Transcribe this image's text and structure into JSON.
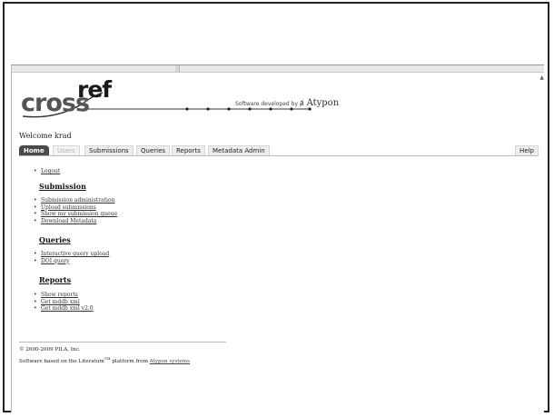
{
  "header": {
    "logo_cross": "cross",
    "logo_ref": "ref",
    "atypon_prefix": "Software developed by",
    "atypon_brand": "Atypon"
  },
  "welcome": "Welcome krad",
  "nav": {
    "tabs": [
      {
        "label": "Home"
      },
      {
        "label": "Users"
      },
      {
        "label": "Submissions"
      },
      {
        "label": "Queries"
      },
      {
        "label": "Reports"
      },
      {
        "label": "Metadata Admin"
      }
    ],
    "help": "Help"
  },
  "menu": {
    "logout": "Logout",
    "submission": {
      "title": "Submission",
      "items": [
        "Submission administration",
        "Upload submissions",
        "Show my submission queue",
        "Download Metadata"
      ]
    },
    "queries": {
      "title": "Queries",
      "items": [
        "Interactive query upload",
        "DOI query"
      ]
    },
    "reports": {
      "title": "Reports",
      "items": [
        "Show reports",
        "Get mddb xml",
        "Get mddb xml v2.0"
      ]
    }
  },
  "footer": {
    "copyright": "© 2000-2009 PILA, Inc.",
    "software_prefix": "Software based on the Literatum",
    "tm": "TM",
    "software_mid": " platform from ",
    "atypon_link": "Atypon systems"
  }
}
